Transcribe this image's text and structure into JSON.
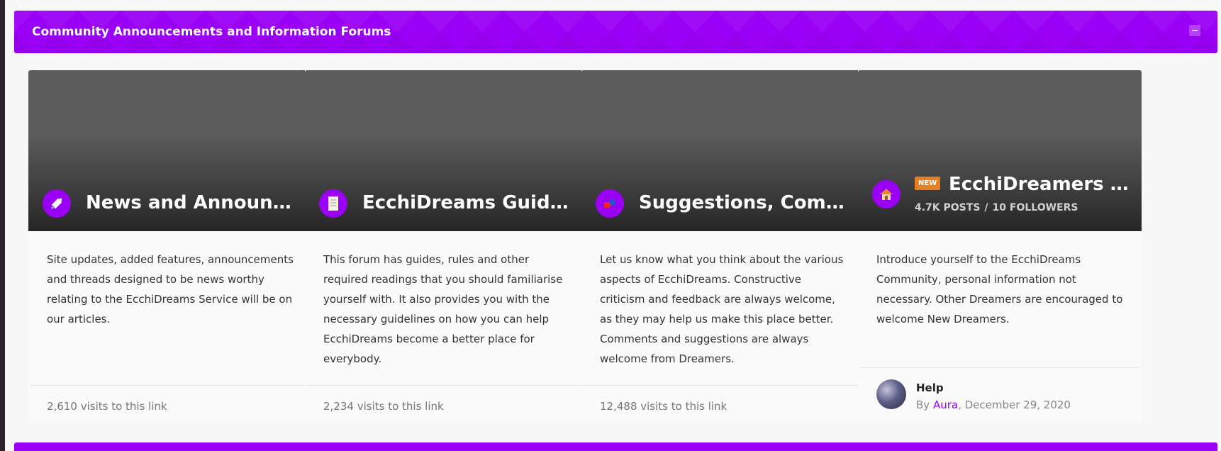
{
  "category": {
    "title": "Community Announcements and Information Forums"
  },
  "forums": [
    {
      "name": "News and Announcements",
      "icon": "megaphone-icon",
      "description": "Site updates, added features, announcements and threads designed to be news worthy relating to the EcchiDreams Service will be on our articles.",
      "visits": "2,610 visits to this link"
    },
    {
      "name": "EcchiDreams Guides, Rules and Information",
      "icon": "document-icon",
      "description": "This forum has guides, rules and other required readings that you should familiarise yourself with. It also provides you with the necessary guidelines on how you can help EcchiDreams become a better place for everybody.",
      "visits": "2,234 visits to this link"
    },
    {
      "name": "Suggestions, Comments and Feedback",
      "icon": "puzzle-icon",
      "description": "Let us know what you think about the various aspects of EcchiDreams. Constructive criticism and feedback are always welcome, as they may help us make this place better. Comments and suggestions are always welcome from Dreamers.",
      "visits": "12,488 visits to this link"
    },
    {
      "name": "EcchiDreamers Welcome",
      "icon": "house-icon",
      "badge": "NEW",
      "posts": "4.7K POSTS",
      "stats_sep": "/",
      "followers": "10 FOLLOWERS",
      "description": "Introduce yourself to the EcchiDreams Community, personal information not necessary. Other Dreamers are encouraged to welcome New Dreamers.",
      "last_post": {
        "title": "Help",
        "by": "By",
        "author": "Aura",
        "date": ", December 29, 2020"
      }
    }
  ],
  "colors": {
    "accent": "#9a00f5",
    "badge": "#e67e22"
  }
}
